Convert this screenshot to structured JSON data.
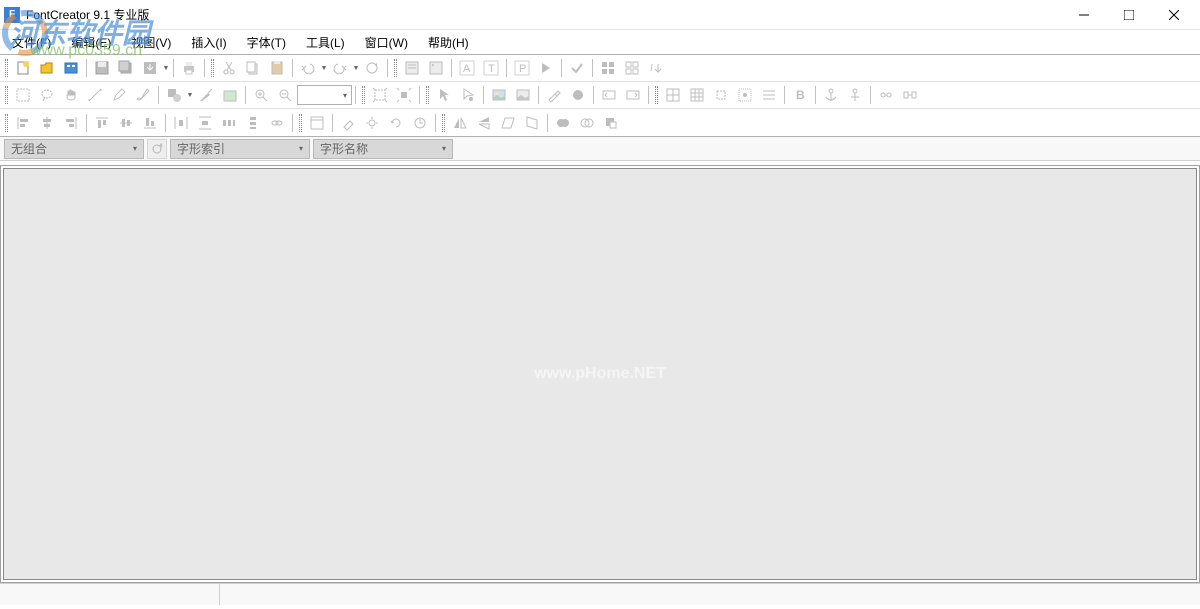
{
  "titlebar": {
    "title": "FontCreator 9.1 专业版"
  },
  "menu": {
    "file": "文件(F)",
    "edit": "编辑(E)",
    "view": "视图(V)",
    "insert": "插入(I)",
    "font": "字体(T)",
    "tools": "工具(L)",
    "window": "窗口(W)",
    "help": "帮助(H)"
  },
  "selectors": {
    "group": "无组合",
    "glyph_index": "字形索引",
    "glyph_name": "字形名称"
  },
  "watermark_main": "河东软件园",
  "watermark_url": "www.pc0359.cn",
  "canvas_watermark": "www.pHome.NET"
}
